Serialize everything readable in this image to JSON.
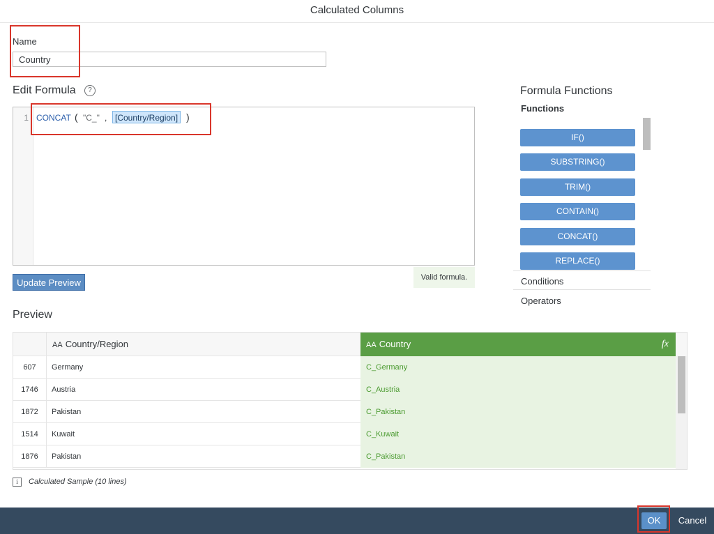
{
  "dialog": {
    "title": "Calculated Columns"
  },
  "name_field": {
    "label": "Name",
    "value": "Country"
  },
  "formula": {
    "section_title": "Edit Formula",
    "help_icon_glyph": "?",
    "line_number": "1",
    "code": {
      "func": "CONCAT",
      "open_paren": "(",
      "string_arg": "\"C_\"",
      "comma": ",",
      "field_token": "[Country/Region]",
      "close_paren": ")"
    },
    "update_preview_label": "Update Preview",
    "validation_message": "Valid formula."
  },
  "functions_panel": {
    "title": "Formula Functions",
    "functions_header": "Functions",
    "functions": [
      "IF()",
      "SUBSTRING()",
      "TRIM()",
      "CONTAIN()",
      "CONCAT()",
      "REPLACE()"
    ],
    "conditions_label": "Conditions",
    "operators_label": "Operators"
  },
  "preview": {
    "title": "Preview",
    "columns": [
      {
        "label": "Country/Region",
        "type_icon": "text-type-icon"
      },
      {
        "label": "Country",
        "type_icon": "text-type-icon",
        "formula_icon": "fx-icon"
      }
    ],
    "text_type_glyph": "AA",
    "fx_glyph": "fx",
    "rows": [
      {
        "id": "607",
        "region": "Germany",
        "country": "C_Germany"
      },
      {
        "id": "1746",
        "region": "Austria",
        "country": "C_Austria"
      },
      {
        "id": "1872",
        "region": "Pakistan",
        "country": "C_Pakistan"
      },
      {
        "id": "1514",
        "region": "Kuwait",
        "country": "C_Kuwait"
      },
      {
        "id": "1876",
        "region": "Pakistan",
        "country": "C_Pakistan"
      }
    ],
    "info_icon_glyph": "i",
    "footnote": "Calculated Sample (10 lines)"
  },
  "footer": {
    "ok_label": "OK",
    "cancel_label": "Cancel"
  },
  "colors": {
    "accent_blue": "#5d93cf",
    "calculated_column_header": "#5a9e45",
    "calculated_column_cell_bg": "#e8f3e2",
    "calculated_text": "#4a9a2f",
    "highlight_red": "#d9362b",
    "footer_bg": "#354a5f"
  }
}
